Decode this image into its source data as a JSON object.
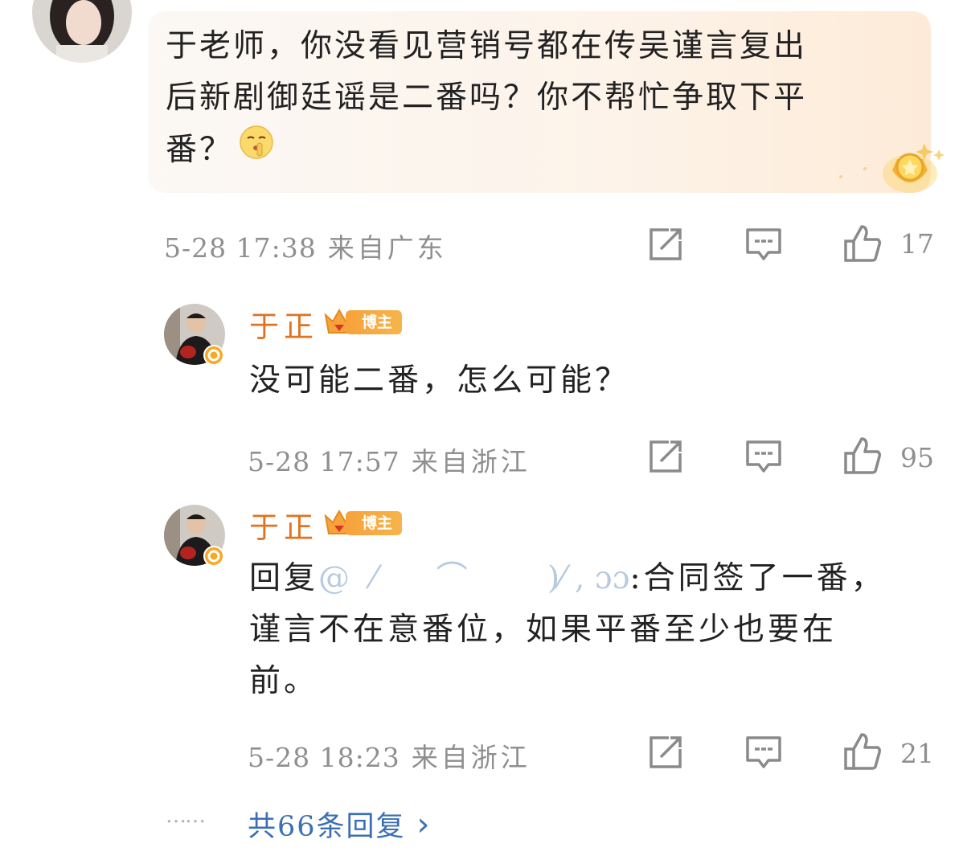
{
  "comment": {
    "text_line1": "于老师，你没看见营销号都在传吴谨言复出",
    "text_line2": "后新剧御廷谣是二番吗？你不帮忙争取下平",
    "text_line3": "番？",
    "emoji_icon": "shush-emoji-icon",
    "time": "5-28 17:38",
    "location": "来自广东",
    "likes": "17"
  },
  "replies": [
    {
      "author": "于正",
      "badge": "博主",
      "text": "没可能二番，怎么可能？",
      "time": "5-28 17:57",
      "location": "来自浙江",
      "likes": "95"
    },
    {
      "author": "于正",
      "badge": "博主",
      "reply_prefix": "回复",
      "mention": "@",
      "text_line1": ":合同签了一番，",
      "text_line2": "谨言不在意番位，如果平番至少也要在",
      "text_line3": "前。",
      "time": "5-28 18:23",
      "location": "来自浙江",
      "likes": "21"
    }
  ],
  "footer": {
    "dots": "……",
    "more_replies": "共66条回复",
    "chevron": "›"
  },
  "colors": {
    "username": "#e1731f",
    "link": "#3b6fb5",
    "meta": "#8f8f8f",
    "badge": "#f7a23a"
  }
}
